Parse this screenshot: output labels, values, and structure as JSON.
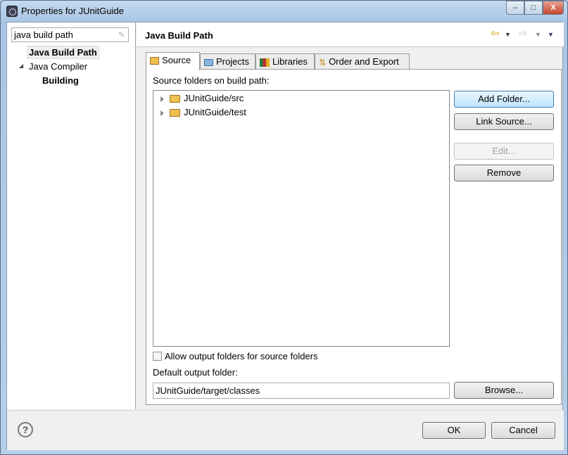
{
  "window": {
    "title": "Properties for JUnitGuide",
    "minimize": "–",
    "maximize": "□",
    "close": "X"
  },
  "sidebar": {
    "filter_value": "java build path",
    "items": [
      {
        "label": "Java Build Path",
        "selected": true
      },
      {
        "label": "Java Compiler",
        "expanded": true
      },
      {
        "label": "Building"
      }
    ]
  },
  "header": {
    "title": "Java Build Path"
  },
  "tabs": [
    {
      "label": "Source",
      "icon": "source-folder-icon",
      "active": true
    },
    {
      "label": "Projects",
      "icon": "project-folder-icon"
    },
    {
      "label": "Libraries",
      "icon": "library-books-icon"
    },
    {
      "label": "Order and Export",
      "icon": "order-arrows-icon"
    }
  ],
  "source": {
    "list_label": "Source folders on build path:",
    "folders": [
      "JUnitGuide/src",
      "JUnitGuide/test"
    ],
    "buttons": {
      "add_folder": "Add Folder...",
      "link_source": "Link Source...",
      "edit": "Edit...",
      "remove": "Remove",
      "browse": "Browse..."
    },
    "allow_output_label": "Allow output folders for source folders",
    "allow_output_checked": false,
    "default_output_label": "Default output folder:",
    "default_output_value": "JUnitGuide/target/classes"
  },
  "footer": {
    "ok": "OK",
    "cancel": "Cancel",
    "help": "?"
  }
}
